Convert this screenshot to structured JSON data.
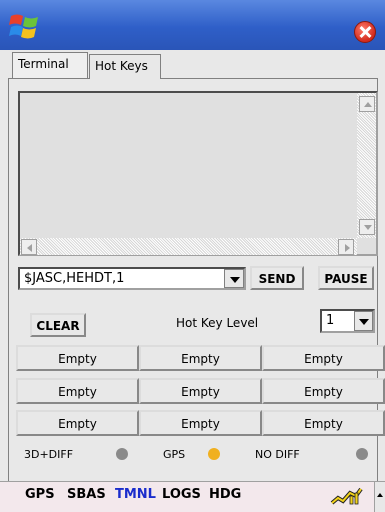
{
  "tabs": {
    "terminal": "Terminal",
    "hotkeys": "Hot Keys"
  },
  "terminal_text": "",
  "command": {
    "value": "$JASC,HEHDT,1"
  },
  "buttons": {
    "send": "SEND",
    "pause": "PAUSE",
    "clear": "CLEAR"
  },
  "hotkey_level": {
    "label": "Hot Key Level",
    "value": "1"
  },
  "hotkeys": [
    "Empty",
    "Empty",
    "Empty",
    "Empty",
    "Empty",
    "Empty",
    "Empty",
    "Empty",
    "Empty"
  ],
  "status": [
    {
      "label": "3D+DIFF",
      "color": "#8a8a8a"
    },
    {
      "label": "GPS",
      "color": "#f0b020"
    },
    {
      "label": "NO DIFF",
      "color": "#8a8a8a"
    }
  ],
  "menu": [
    "GPS",
    "SBAS",
    "TMNL",
    "LOGS",
    "HDG"
  ],
  "menu_active_color": "#1a2ccc",
  "icons": {
    "start": "windows-flag-icon",
    "close": "close-icon",
    "tray": "signal-icon"
  }
}
